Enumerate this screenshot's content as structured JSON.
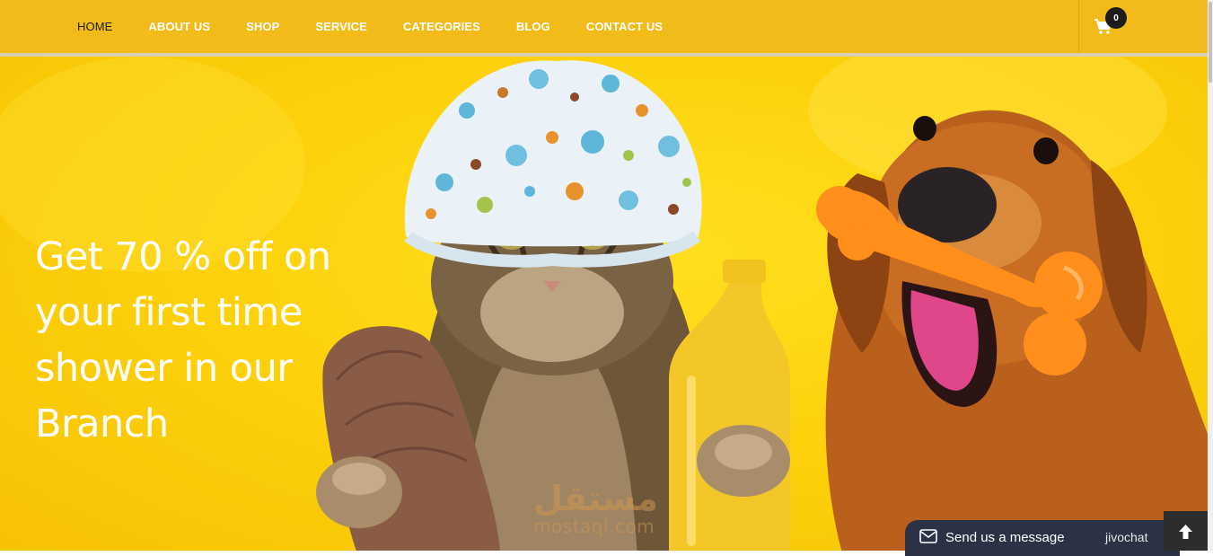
{
  "nav": {
    "items": [
      {
        "label": "HOME",
        "active": true
      },
      {
        "label": "ABOUT US"
      },
      {
        "label": "SHOP"
      },
      {
        "label": "SERVICE"
      },
      {
        "label": "CATEGORIES"
      },
      {
        "label": "BLOG"
      },
      {
        "label": "CONTACT US"
      }
    ],
    "cart_count": "0",
    "cart_icon": "shopping-cart-icon"
  },
  "hero": {
    "title": "Get 70 % off on your first time shower in our Branch"
  },
  "watermark": {
    "arabic": "مستقل",
    "latin": "mostaql.com"
  },
  "chat": {
    "label": "Send us a message",
    "brand": "jivochat",
    "icon": "envelope-icon"
  },
  "scroll_top": {
    "icon": "arrow-up-icon"
  },
  "colors": {
    "navbar": "#f2bb1a",
    "hero_background": "#fdd20c",
    "chat_background": "#2b3245",
    "badge": "#1d1d1d"
  }
}
